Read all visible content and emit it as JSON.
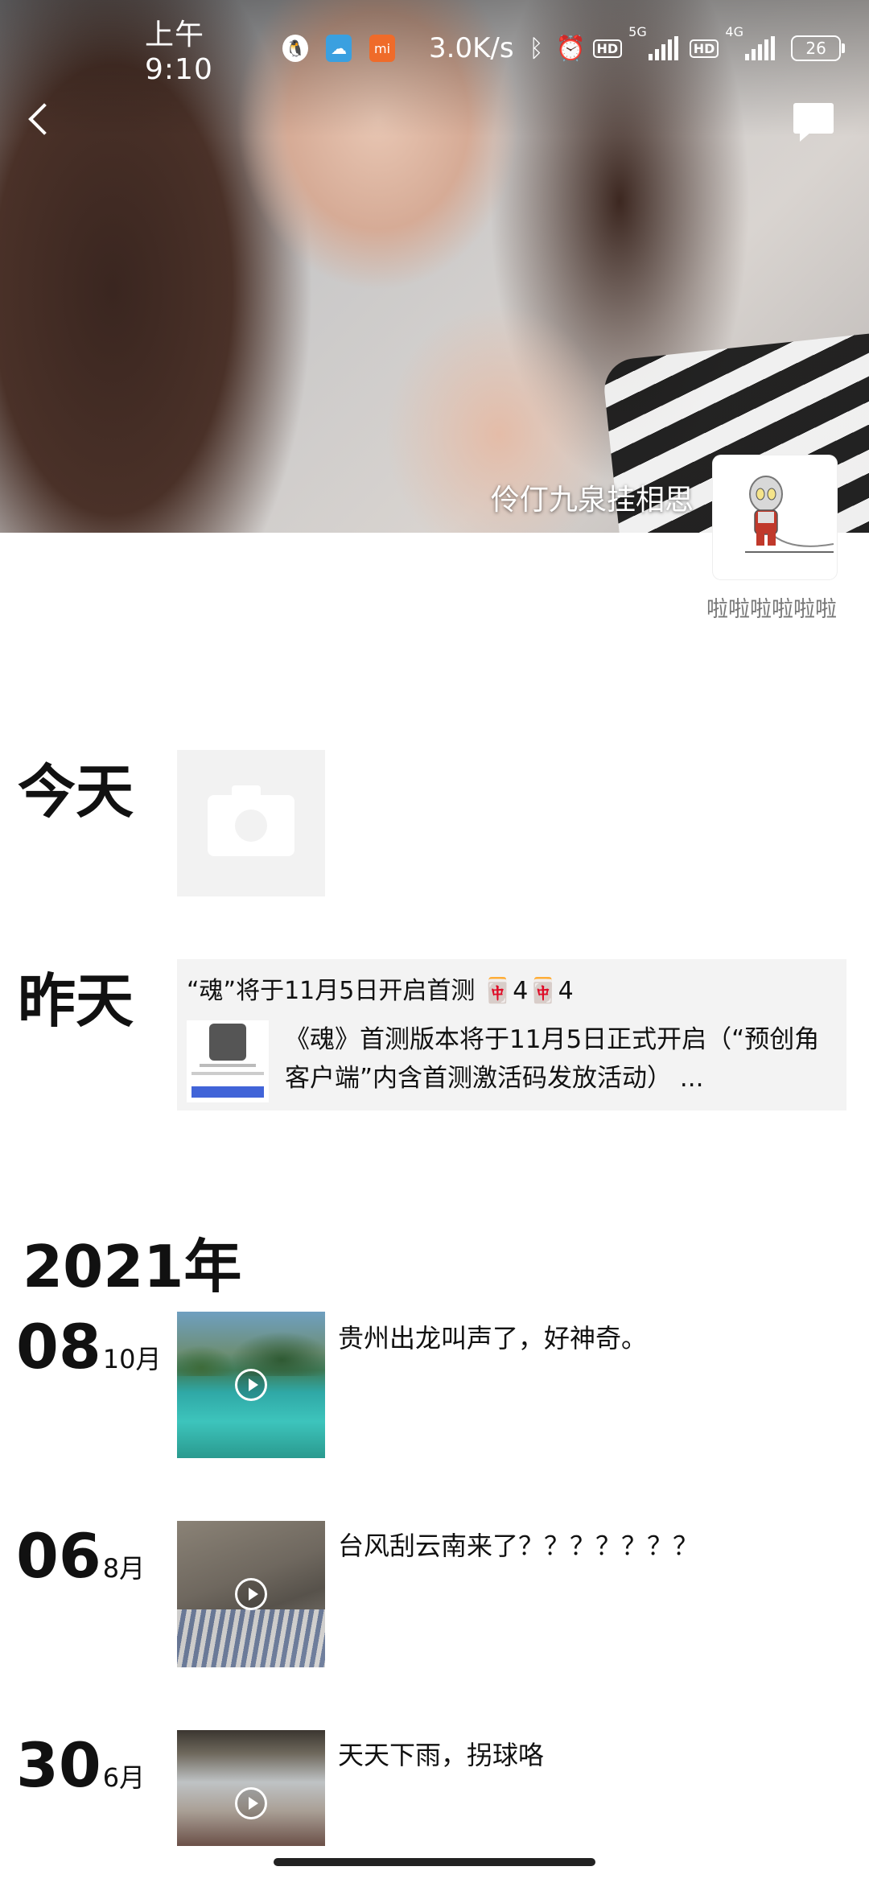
{
  "status_bar": {
    "time": "上午9:10",
    "icons": [
      "qq-icon",
      "cloud-icon",
      "mi-icon"
    ],
    "speed": "3.0K/s",
    "hd_label": "HD",
    "net1": "5G",
    "net2": "4G",
    "battery": "26"
  },
  "profile": {
    "username": "伶仃九泉挂相思",
    "signature": "啦啦啦啦啦啦"
  },
  "timeline": {
    "today_label": "今天",
    "yesterday_label": "昨天",
    "shared": {
      "title": "“魂”将于11月5日开启首测 🀄4🀄4",
      "description": "《魂》首测版本将于11月5日正式开启（“预创角客户端”内含首测激活码发放活动） ..."
    },
    "year_label": "2021年",
    "posts": [
      {
        "day": "08",
        "month": "10月",
        "text": "贵州出龙叫声了，好神奇。"
      },
      {
        "day": "06",
        "month": "8月",
        "text": "台风刮云南来了？？？？？？？"
      },
      {
        "day": "30",
        "month": "6月",
        "text": "天天下雨，拐球咯"
      }
    ]
  }
}
